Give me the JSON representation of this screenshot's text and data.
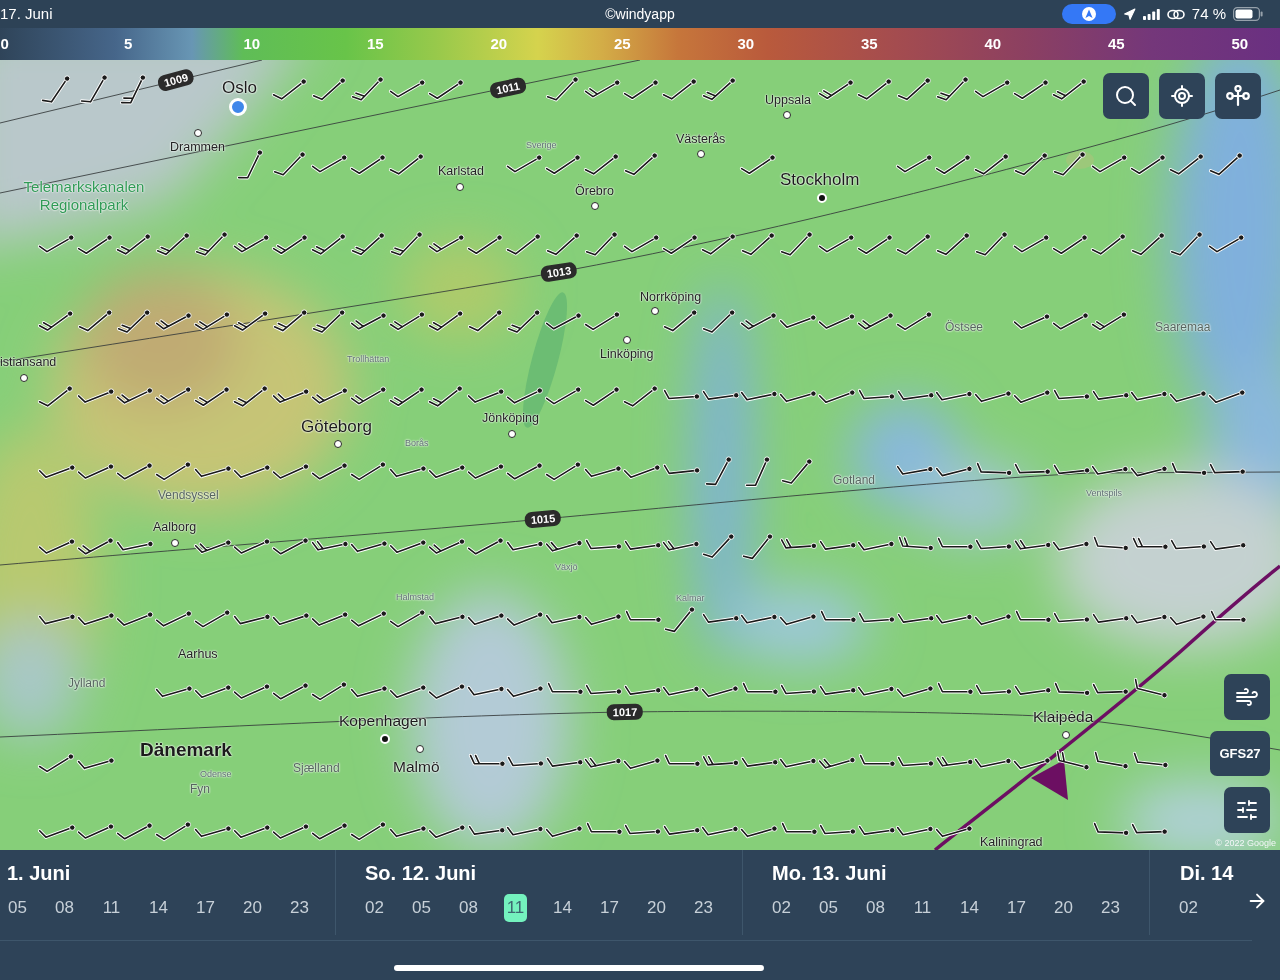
{
  "status_bar": {
    "date": "17. Juni",
    "credit": "©windyapp",
    "battery": "74 %"
  },
  "scale": {
    "ticks": [
      "0",
      "5",
      "10",
      "15",
      "20",
      "25",
      "30",
      "35",
      "40",
      "45",
      "50"
    ]
  },
  "map": {
    "isobars": [
      {
        "label": "1009"
      },
      {
        "label": "1011"
      },
      {
        "label": "1013"
      },
      {
        "label": "1015"
      },
      {
        "label": "1017"
      }
    ],
    "labels": [
      {
        "text": "Oslo",
        "kind": "capital"
      },
      {
        "text": "Uppsala",
        "kind": "city"
      },
      {
        "text": "Drammen",
        "kind": "city"
      },
      {
        "text": "Sverige",
        "kind": "minor"
      },
      {
        "text": "Västerås",
        "kind": "city"
      },
      {
        "text": "Telemarkskanalen Regionalpark",
        "kind": "park"
      },
      {
        "text": "Karlstad",
        "kind": "city"
      },
      {
        "text": "Örebro",
        "kind": "city"
      },
      {
        "text": "Stockholm",
        "kind": "capital"
      },
      {
        "text": "Norrköping",
        "kind": "city"
      },
      {
        "text": "Östsee",
        "kind": "region"
      },
      {
        "text": "Saaremaa",
        "kind": "region"
      },
      {
        "text": "istiansand",
        "kind": "city"
      },
      {
        "text": "Trollhättan",
        "kind": "minor"
      },
      {
        "text": "Linköping",
        "kind": "city"
      },
      {
        "text": "Göteborg",
        "kind": "capital"
      },
      {
        "text": "Jönköping",
        "kind": "city"
      },
      {
        "text": "Borås",
        "kind": "minor"
      },
      {
        "text": "Gotland",
        "kind": "region"
      },
      {
        "text": "Vendsyssel",
        "kind": "region"
      },
      {
        "text": "Ventspils",
        "kind": "minor"
      },
      {
        "text": "Aalborg",
        "kind": "city"
      },
      {
        "text": "Växjö",
        "kind": "minor"
      },
      {
        "text": "Halmstad",
        "kind": "minor"
      },
      {
        "text": "Kalmar",
        "kind": "minor"
      },
      {
        "text": "Aarhus",
        "kind": "city"
      },
      {
        "text": "Jylland",
        "kind": "region"
      },
      {
        "text": "Kopenhagen",
        "kind": "city-large"
      },
      {
        "text": "Klaipėda",
        "kind": "city-large"
      },
      {
        "text": "Dänemark",
        "kind": "country"
      },
      {
        "text": "Sjælland",
        "kind": "region"
      },
      {
        "text": "Malmö",
        "kind": "city-large"
      },
      {
        "text": "Odense",
        "kind": "minor"
      },
      {
        "text": "Fyn",
        "kind": "region"
      },
      {
        "text": "Kaliningrad",
        "kind": "city"
      }
    ],
    "markers": [
      {
        "kind": "location"
      },
      {
        "kind": "ring"
      },
      {
        "kind": "ring"
      },
      {
        "kind": "ring"
      },
      {
        "kind": "ring"
      },
      {
        "kind": "dot"
      },
      {
        "kind": "ring"
      },
      {
        "kind": "ring"
      },
      {
        "kind": "ring"
      },
      {
        "kind": "ring"
      },
      {
        "kind": "ring"
      },
      {
        "kind": "ring"
      },
      {
        "kind": "ring"
      },
      {
        "kind": "dot"
      },
      {
        "kind": "ring"
      },
      {
        "kind": "ring"
      }
    ],
    "attribution": "© 2022 Google"
  },
  "controls": {
    "top": [
      {
        "kind": "search"
      },
      {
        "kind": "locate"
      },
      {
        "kind": "route"
      }
    ],
    "side": [
      {
        "kind": "wind"
      },
      {
        "kind": "model",
        "label": "GFS27"
      },
      {
        "kind": "filters"
      }
    ]
  },
  "timeline": {
    "days": [
      {
        "label": "1. Juni",
        "hours": [
          {
            "label": "05",
            "selected": false
          },
          {
            "label": "08",
            "selected": false
          },
          {
            "label": "11",
            "selected": false
          },
          {
            "label": "14",
            "selected": false
          },
          {
            "label": "17",
            "selected": false
          },
          {
            "label": "20",
            "selected": false
          },
          {
            "label": "23",
            "selected": false
          }
        ]
      },
      {
        "label": "So. 12. Juni",
        "hours": [
          {
            "label": "02",
            "selected": false
          },
          {
            "label": "05",
            "selected": false
          },
          {
            "label": "08",
            "selected": false
          },
          {
            "label": "11",
            "selected": true
          },
          {
            "label": "14",
            "selected": false
          },
          {
            "label": "17",
            "selected": false
          },
          {
            "label": "20",
            "selected": false
          },
          {
            "label": "23",
            "selected": false
          }
        ]
      },
      {
        "label": "Mo. 13. Juni",
        "hours": [
          {
            "label": "02",
            "selected": false
          },
          {
            "label": "05",
            "selected": false
          },
          {
            "label": "08",
            "selected": false
          },
          {
            "label": "11",
            "selected": false
          },
          {
            "label": "14",
            "selected": false
          },
          {
            "label": "17",
            "selected": false
          },
          {
            "label": "20",
            "selected": false
          },
          {
            "label": "23",
            "selected": false
          }
        ]
      },
      {
        "label": "Di. 14",
        "hours": [
          {
            "label": "02",
            "selected": false
          }
        ]
      }
    ]
  }
}
